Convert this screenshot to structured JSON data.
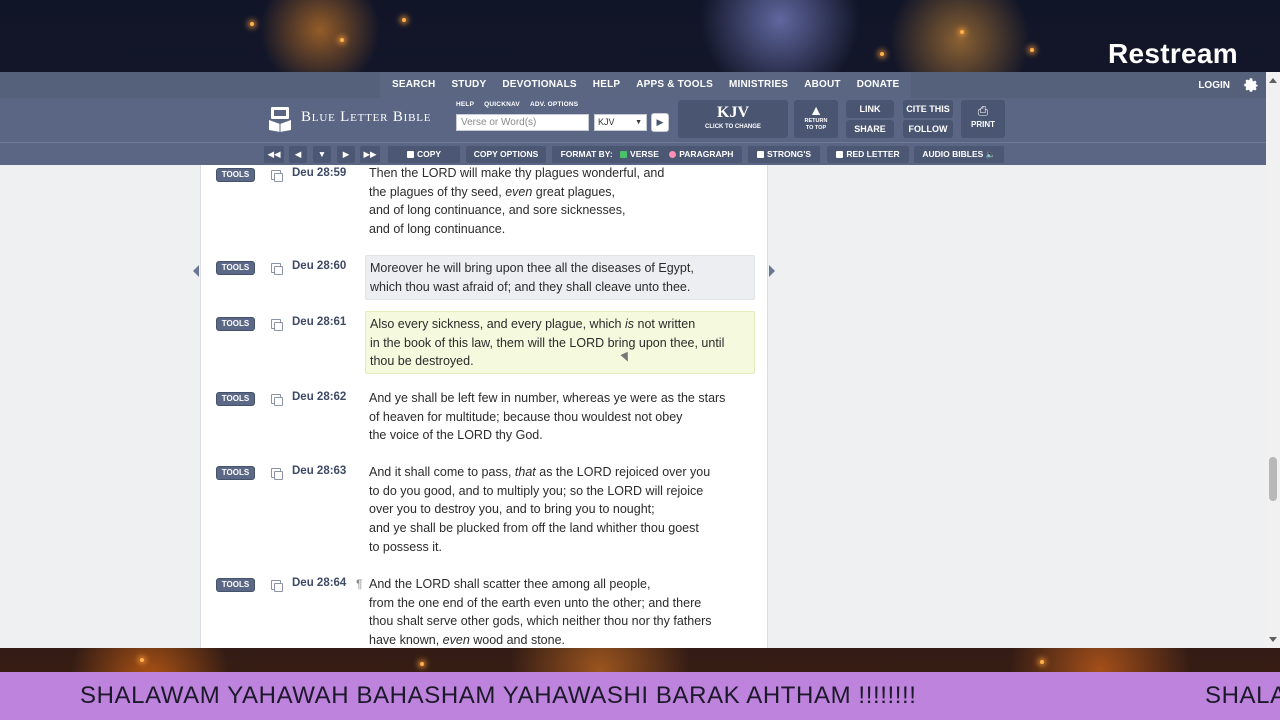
{
  "stream": {
    "brand": "Restream",
    "ticker_text": "SHALAWAM YAHAWAH BAHASHAM YAHAWASHI BARAK AHTHAM !!!!!!!!",
    "ticker_text_repeat": "SHALA"
  },
  "nav": {
    "items": [
      "SEARCH",
      "STUDY",
      "DEVOTIONALS",
      "HELP",
      "APPS & TOOLS",
      "MINISTRIES",
      "ABOUT",
      "DONATE"
    ],
    "login": "LOGIN"
  },
  "header": {
    "logo_text": "Blue Letter Bible",
    "mini_links": [
      "HELP",
      "QUICKNAV",
      "ADV. OPTIONS"
    ],
    "search_placeholder": "Verse or Word(s)",
    "version_selected": "KJV",
    "version_caret": "▼",
    "go": "▶",
    "kjv_label": "KJV",
    "kjv_sub": "CLICK TO CHANGE",
    "return_arrow": "▲",
    "return_line1": "RETURN",
    "return_line2": "TO TOP",
    "link": "LINK",
    "share": "SHARE",
    "cite": "CITE THIS",
    "follow": "FOLLOW",
    "print_icon": "⎙",
    "print": "PRINT"
  },
  "toolbar": {
    "first": "◀◀",
    "prev": "◀",
    "chapter": "▼",
    "next": "▶",
    "last": "▶▶",
    "copy": "COPY",
    "copy_options": "COPY OPTIONS",
    "format_by": "FORMAT BY:",
    "verse": "VERSE",
    "paragraph": "PARAGRAPH",
    "strongs": "STRONG'S",
    "red_letter": "RED LETTER",
    "audio_bibles": "AUDIO BIBLES",
    "audio_icon": "🔈"
  },
  "tools_label": "TOOLS",
  "verses": [
    {
      "ref": "Deu 28:59",
      "lines": [
        "Then the LORD will make thy plagues wonderful, and",
        "the plagues of thy seed, {even} great plagues,",
        "and of long continuance, and sore sicknesses,",
        "and of long continuance."
      ]
    },
    {
      "ref": "Deu 28:60",
      "lines": [
        "Moreover he will bring upon thee all the diseases of Egypt,",
        "which thou wast afraid of; and they shall cleave unto thee."
      ]
    },
    {
      "ref": "Deu 28:61",
      "lines": [
        "Also every sickness, and every plague, which {is} not written",
        "in the book of this law, them will the LORD bring upon thee, until",
        "thou be destroyed."
      ]
    },
    {
      "ref": "Deu 28:62",
      "lines": [
        "And ye shall be left few in number, whereas ye were as the stars",
        "of heaven for multitude; because thou wouldest not obey",
        "the voice of the LORD thy God."
      ]
    },
    {
      "ref": "Deu 28:63",
      "lines": [
        "And it shall come to pass, {that} as the LORD rejoiced over you",
        "to do you good, and to multiply you; so the LORD will rejoice",
        "over you to destroy you, and to bring you to nought;",
        "and ye shall be plucked from off the land whither thou goest",
        "to possess it."
      ]
    },
    {
      "ref": "Deu 28:64",
      "pilcrow": "¶",
      "lines": [
        "And the LORD shall scatter thee among all people,",
        "from the one end of the earth even unto the other; and there",
        "thou shalt serve other gods, which neither thou nor thy fathers",
        "have known, {even} wood and stone."
      ]
    }
  ]
}
